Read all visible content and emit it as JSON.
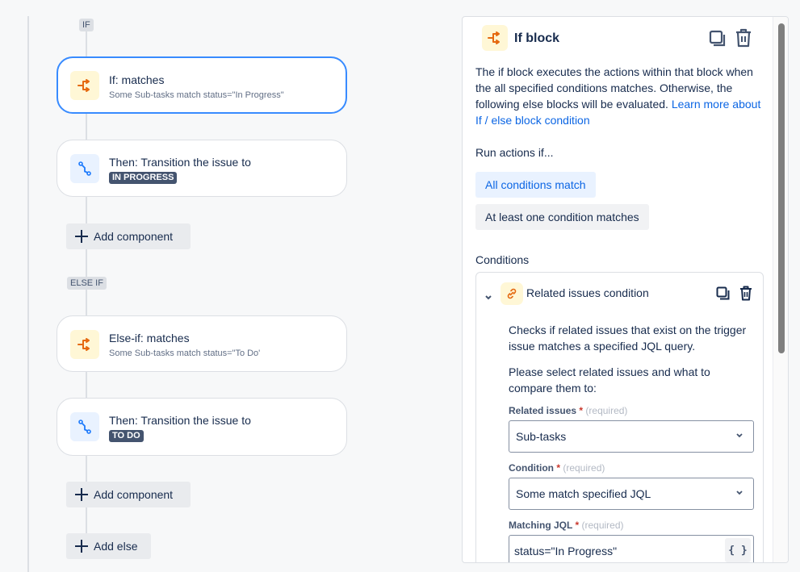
{
  "flow": {
    "if_lozenge": "IF",
    "else_if_lozenge": "ELSE IF",
    "if_card": {
      "title": "If: matches",
      "subtitle": "Some Sub-tasks match status=\"In Progress\""
    },
    "then_card_1": {
      "title": "Then: Transition the issue to",
      "status": "IN PROGRESS"
    },
    "add_component_1": "Add component",
    "else_if_card": {
      "title": "Else-if: matches",
      "subtitle": "Some Sub-tasks match status=\"To Do'"
    },
    "then_card_2": {
      "title": "Then: Transition the issue to",
      "status": "TO DO"
    },
    "add_component_2": "Add component",
    "add_else": "Add else"
  },
  "panel": {
    "title": "If block",
    "description": "The if block executes the actions within that block when the all specified conditions matches. Otherwise, the following else blocks will be evaluated. ",
    "learn_more_link": "Learn more about If / else block condition",
    "run_actions_label": "Run actions if...",
    "options": [
      {
        "label": "All conditions match",
        "selected": true
      },
      {
        "label": "At least one condition matches",
        "selected": false
      }
    ],
    "conditions_label": "Conditions",
    "condition": {
      "title": "Related issues condition",
      "description": "Checks if related issues that exist on the trigger issue matches a specified JQL query.",
      "instruction": "Please select related issues and what to compare them to:",
      "fields": {
        "related_issues": {
          "label": "Related issues",
          "required_text": "(required)",
          "value": "Sub-tasks"
        },
        "condition": {
          "label": "Condition",
          "required_text": "(required)",
          "value": "Some match specified JQL"
        },
        "matching_jql": {
          "label": "Matching JQL",
          "required_text": "(required)",
          "value": "status=\"In Progress\"",
          "smart_values_button": "{ }"
        }
      }
    }
  },
  "colors": {
    "accent": "#0c66e4",
    "selected_border": "#388bff",
    "branch_icon": "#e56910",
    "transition_icon": "#1d7afc"
  }
}
